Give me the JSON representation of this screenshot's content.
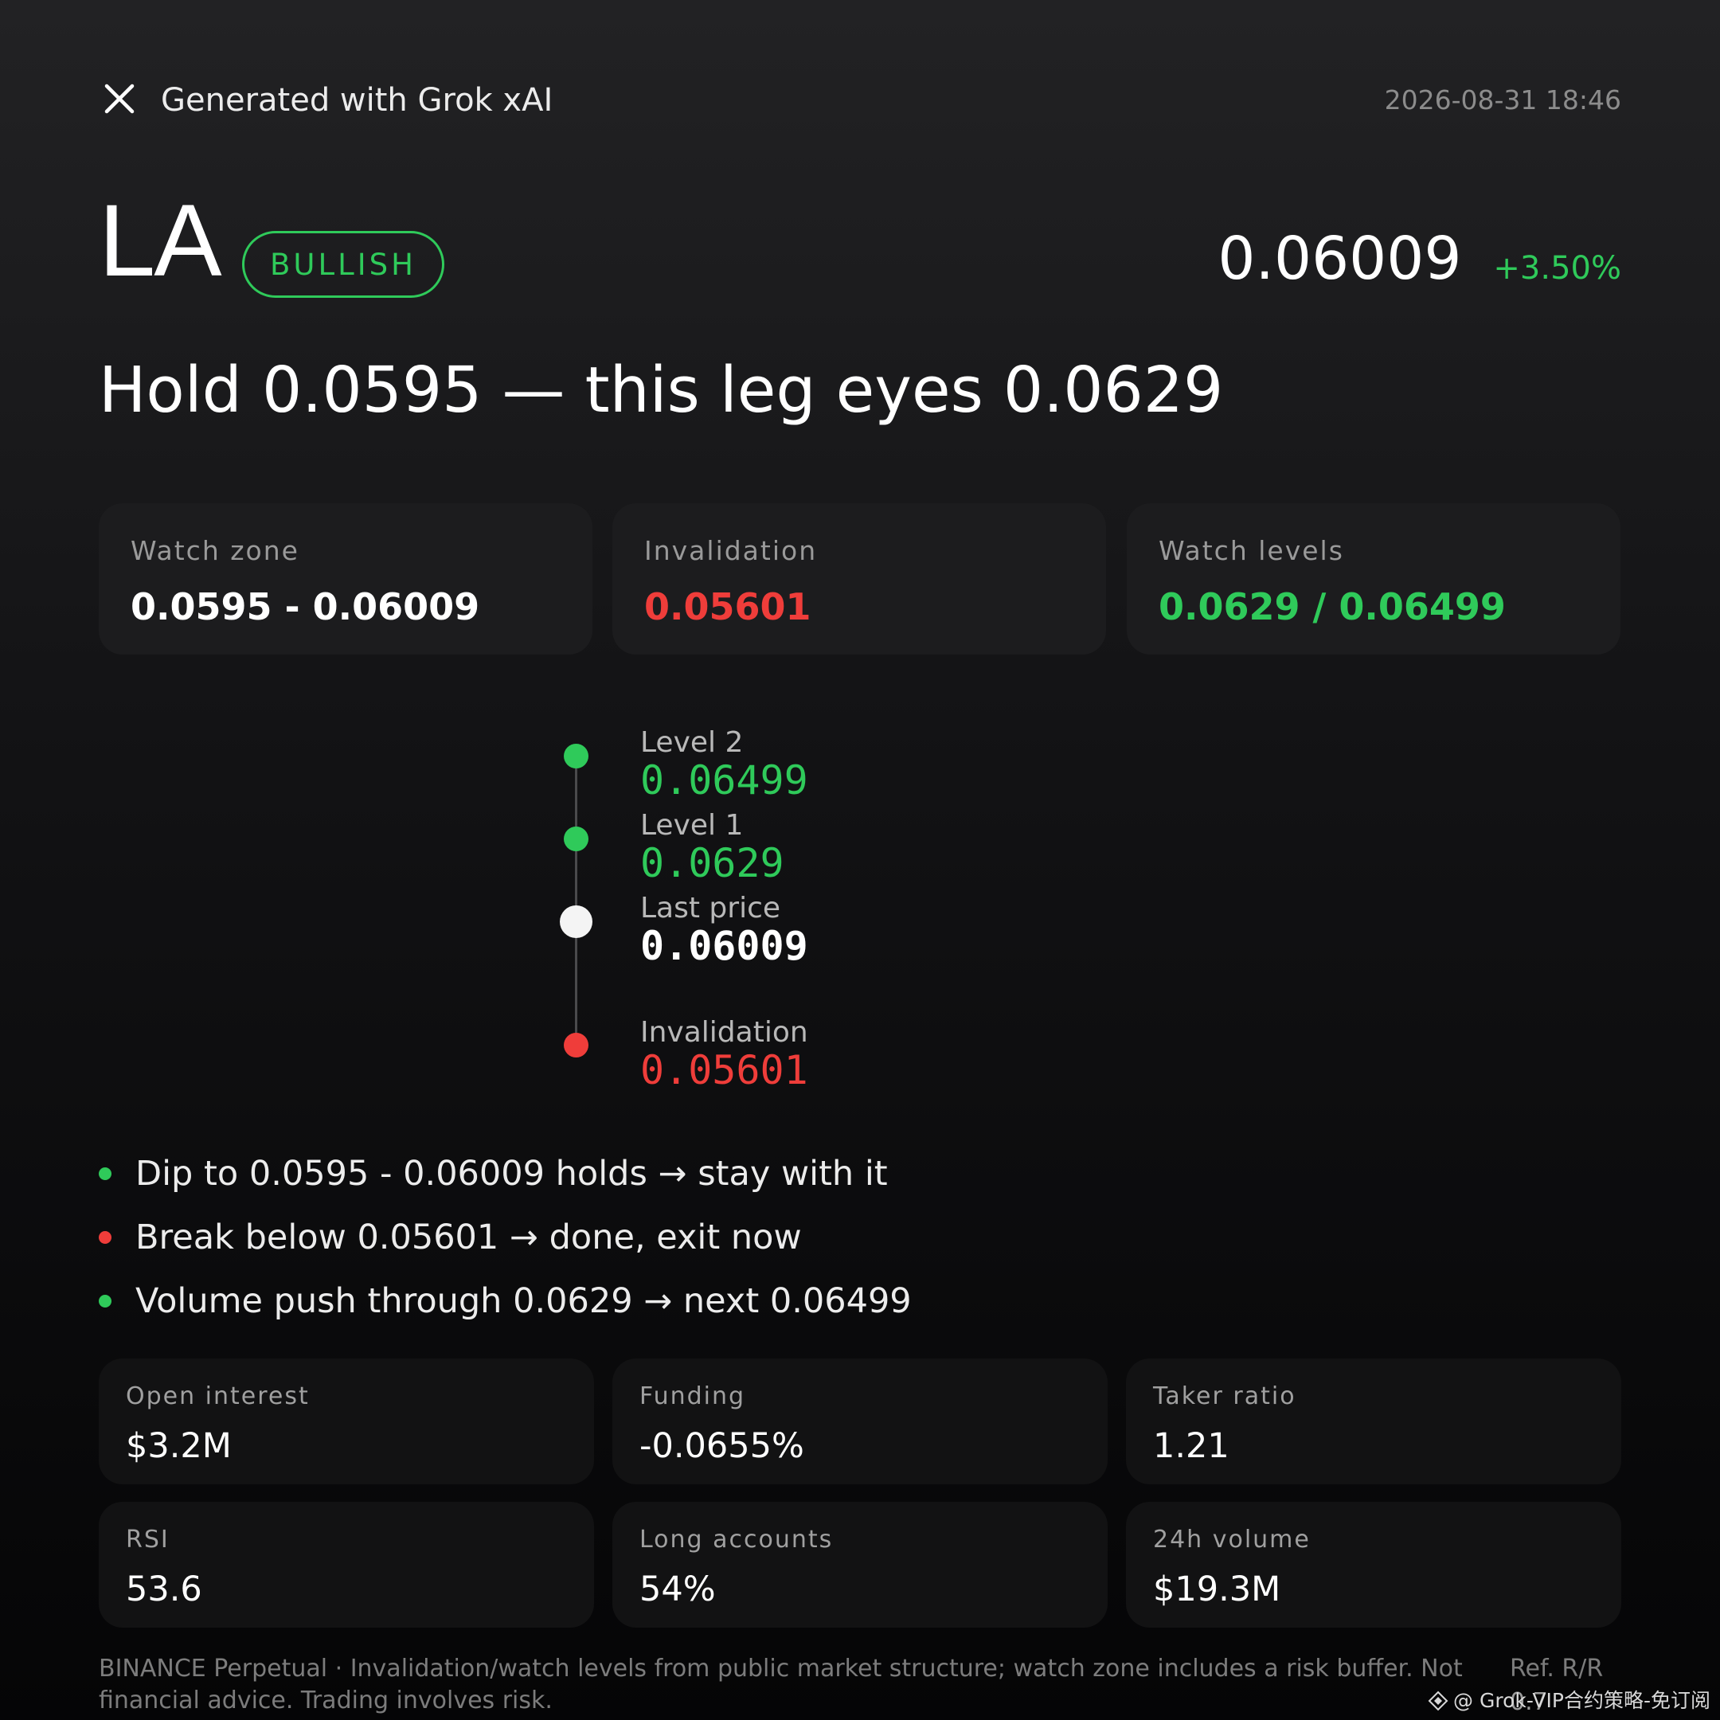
{
  "header": {
    "generated_label": "Generated with Grok xAI",
    "timestamp": "2026-08-31 18:46"
  },
  "ticker": {
    "symbol": "LA",
    "sentiment": "BULLISH",
    "price": "0.06009",
    "change": "+3.50%"
  },
  "headline": "Hold 0.0595 — this leg eyes 0.0629",
  "summary_cards": [
    {
      "label": "Watch zone",
      "value": "0.0595 - 0.06009"
    },
    {
      "label": "Invalidation",
      "value": "0.05601"
    },
    {
      "label": "Watch levels",
      "value": "0.0629 / 0.06499"
    }
  ],
  "ladder": [
    {
      "label": "Level 2",
      "value": "0.06499"
    },
    {
      "label": "Level 1",
      "value": "0.0629"
    },
    {
      "label": "Last price",
      "value": "0.06009"
    },
    {
      "label": "Invalidation",
      "value": "0.05601"
    }
  ],
  "bullets": [
    "Dip to 0.0595 - 0.06009 holds → stay with it",
    "Break below 0.05601 → done, exit now",
    "Volume push through 0.0629 → next 0.06499"
  ],
  "stats": [
    {
      "label": "Open interest",
      "value": "$3.2M"
    },
    {
      "label": "Funding",
      "value": "-0.0655%"
    },
    {
      "label": "Taker ratio",
      "value": "1.21"
    },
    {
      "label": "RSI",
      "value": "53.6"
    },
    {
      "label": "Long accounts",
      "value": "54%"
    },
    {
      "label": "24h volume",
      "value": "$19.3M"
    }
  ],
  "footer": {
    "disclaimer": "BINANCE Perpetual · Invalidation/watch levels from public market structure; watch zone includes a risk buffer. Not financial advice. Trading involves risk.",
    "ref_label": "Ref. R/R",
    "ref_value": "0.7"
  },
  "watermark": "@ Grok-VIP合约策略-免订阅",
  "colors": {
    "green": "#2fca5a",
    "red": "#ef3d3a",
    "white": "#ffffff"
  }
}
